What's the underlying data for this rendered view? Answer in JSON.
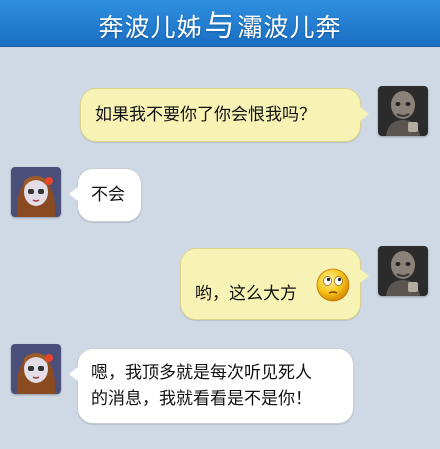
{
  "header": {
    "title_left": "奔波儿姊",
    "title_sep": "与",
    "title_right": "灞波儿奔"
  },
  "messages": [
    {
      "side": "right",
      "sender": "male-avatar",
      "text": "如果我不要你了你会恨我吗？"
    },
    {
      "side": "left",
      "sender": "female-avatar",
      "text": "不会"
    },
    {
      "side": "right",
      "sender": "male-avatar",
      "text": "哟，这么大方",
      "emoji": "wondering-face-emoji"
    },
    {
      "side": "left",
      "sender": "female-avatar",
      "text_line1": "嗯，我顶多就是每次听见死人",
      "text_line2": "的消息，我就看看是不是你！"
    }
  ],
  "colors": {
    "background": "#cfd9e6",
    "titlebar": "#1a6fc3",
    "bubble_right": "#f7f3b4",
    "bubble_left": "#ffffff"
  }
}
